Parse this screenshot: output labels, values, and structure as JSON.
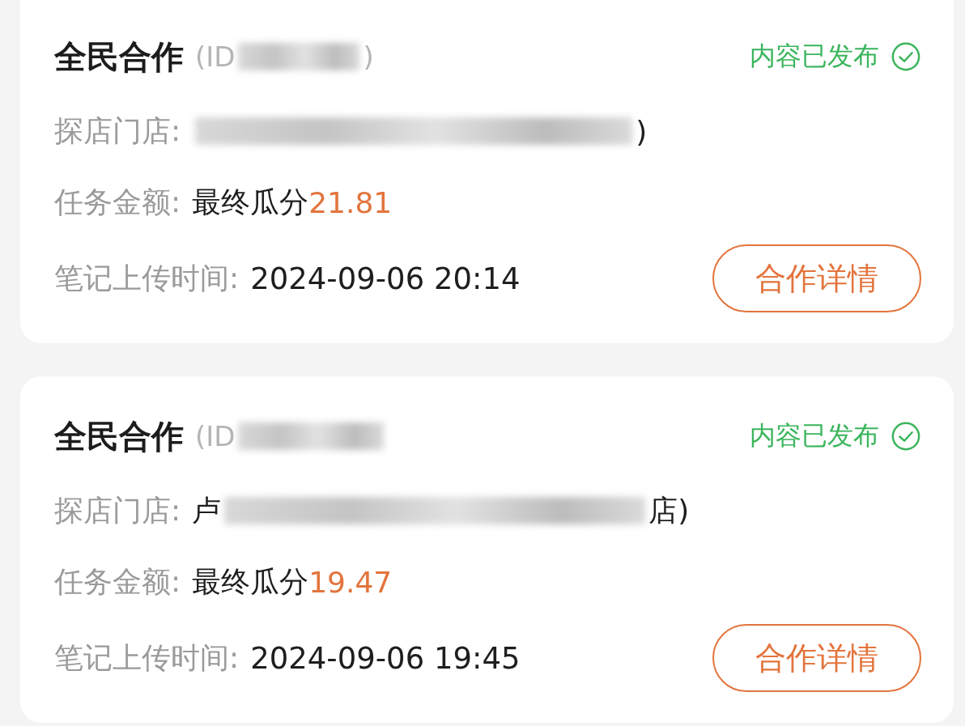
{
  "cards": [
    {
      "title": "全民合作",
      "id": {
        "before": "(ID",
        "after": ")"
      },
      "status": {
        "text": "内容已发布",
        "kind": "published"
      },
      "store_label": "探店门店:",
      "store": {
        "after": ")"
      },
      "amount_label": "任务金额:",
      "amount_prefix": "最终瓜分",
      "amount": "21.81",
      "time_label": "笔记上传时间:",
      "time": "2024-09-06 20:14",
      "button": "合作详情"
    },
    {
      "title": "全民合作",
      "id": {
        "before": "(ID"
      },
      "status": {
        "text": "内容已发布",
        "kind": "published"
      },
      "store_label": "探店门店:",
      "store": {
        "before": "卢",
        "after": "店)"
      },
      "amount_label": "任务金额:",
      "amount_prefix": "最终瓜分",
      "amount": "19.47",
      "time_label": "笔记上传时间:",
      "time": "2024-09-06 19:45",
      "button": "合作详情"
    }
  ]
}
